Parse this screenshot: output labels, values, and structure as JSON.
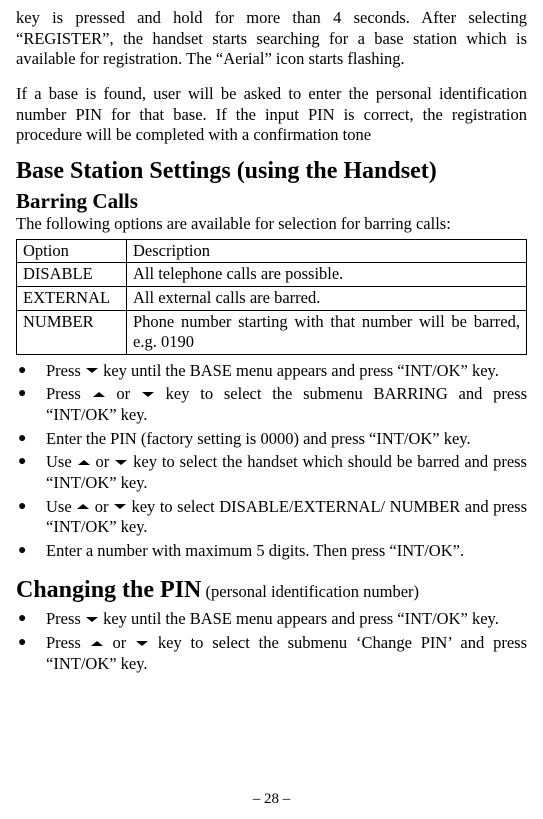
{
  "intro": {
    "p1": "key is pressed and hold for more than 4 seconds.   After selecting “REGISTER”, the handset starts searching for a base station which is available for registration. The “Aerial” icon starts flashing.",
    "p2": "If a base is found, user will be asked to enter the personal identification number PIN for that base. If the input PIN is correct, the registration procedure will be completed with a confirmation tone"
  },
  "h1": "Base Station Settings (using the Handset)",
  "barring": {
    "title": "Barring Calls",
    "lead": "The following options are available for selection for barring calls:",
    "table": {
      "header": {
        "c1": "Option",
        "c2": "Description"
      },
      "rows": [
        {
          "c1": "DISABLE",
          "c2": "All telephone calls are possible."
        },
        {
          "c1": "EXTERNAL",
          "c2": "All external calls are barred."
        },
        {
          "c1": "NUMBER",
          "c2": "Phone number starting with that number will be barred, e.g. 0190"
        }
      ]
    },
    "steps": [
      {
        "pre": "Press ",
        "sym": "down",
        "post": " key until the BASE menu appears and press “INT/OK” key."
      },
      {
        "pre": "Press ",
        "sym": "updown",
        "post": " key to select the submenu BARRING and press “INT/OK” key."
      },
      {
        "plain": "Enter the PIN (factory setting is 0000) and press “INT/OK” key."
      },
      {
        "pre": "Use ",
        "sym": "updown",
        "post": " key to select the handset which should be barred and press “INT/OK” key."
      },
      {
        "pre": "Use ",
        "sym": "updown",
        "post": " key to select DISABLE/EXTERNAL/ NUMBER and press “INT/OK” key."
      },
      {
        "plain": "Enter a number with maximum 5 digits. Then press “INT/OK”."
      }
    ]
  },
  "changing": {
    "title": "Changing the PIN",
    "suffix": " (personal identification number)",
    "steps": [
      {
        "pre": "Press ",
        "sym": "down",
        "post": " key until the BASE menu appears and press “INT/OK” key."
      },
      {
        "pre": "Press ",
        "sym": "updown",
        "post": " key to select the submenu ‘Change PIN’ and press “INT/OK” key."
      }
    ]
  },
  "or": " or ",
  "footer": "– 28 –"
}
